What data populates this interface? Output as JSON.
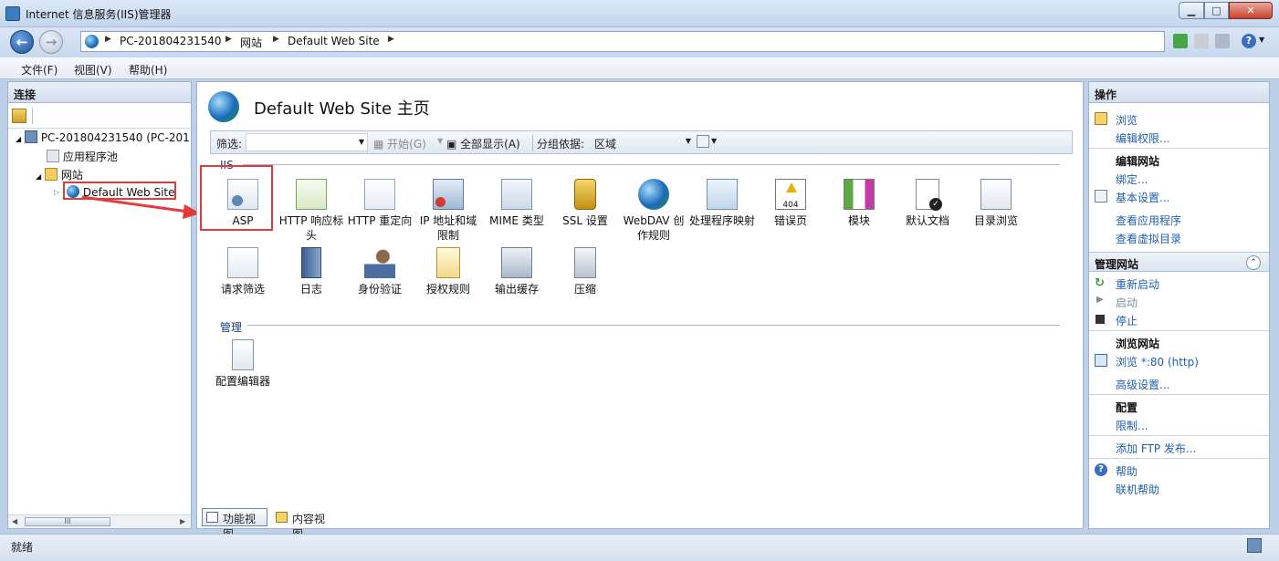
{
  "window": {
    "title": "Internet 信息服务(IIS)管理器"
  },
  "address": {
    "crumbs": [
      "PC-201804231540",
      "网站",
      "Default Web Site"
    ]
  },
  "menu": {
    "file": "文件(F)",
    "view": "视图(V)",
    "help": "帮助(H)"
  },
  "left": {
    "header": "连接",
    "tree": {
      "server": "PC-201804231540 (PC-201",
      "apppools": "应用程序池",
      "sites": "网站",
      "site": "Default Web Site"
    },
    "scroll_label": "III"
  },
  "center": {
    "title": "Default Web Site 主页",
    "filter": {
      "label": "筛选:",
      "start": "开始(G)",
      "showall": "全部显示(A)",
      "groupby_label": "分组依据:",
      "groupby_value": "区域"
    },
    "sections": {
      "iis": "IIS",
      "manage": "管理"
    },
    "features_row1": [
      "ASP",
      "HTTP 响应标头",
      "HTTP 重定向",
      "IP 地址和域限制",
      "MIME 类型",
      "SSL 设置",
      "WebDAV 创作规则",
      "处理程序映射",
      "错误页",
      "模块",
      "默认文档",
      "目录浏览"
    ],
    "features_row2": [
      "请求筛选",
      "日志",
      "身份验证",
      "授权规则",
      "输出缓存",
      "压缩"
    ],
    "features_manage": [
      "配置编辑器"
    ],
    "error_icon_text": "404"
  },
  "bottom": {
    "feature_view": "功能视图",
    "content_view": "内容视图"
  },
  "right": {
    "header": "操作",
    "browse": "浏览",
    "edit_perms": "编辑权限...",
    "edit_site": "编辑网站",
    "bindings": "绑定...",
    "basic_settings": "基本设置...",
    "view_apps": "查看应用程序",
    "view_vdirs": "查看虚拟目录",
    "manage_site": "管理网站",
    "restart": "重新启动",
    "start": "启动",
    "stop": "停止",
    "browse_site": "浏览网站",
    "browse_80": "浏览 *:80 (http)",
    "advanced": "高级设置...",
    "config": "配置",
    "limits": "限制...",
    "add_ftp": "添加 FTP 发布...",
    "help": "帮助",
    "online_help": "联机帮助"
  },
  "status": {
    "text": "就绪"
  },
  "colors": {
    "link": "#1f5fae",
    "highlight": "#e33b3b",
    "panel_border": "#9fb3cd"
  }
}
